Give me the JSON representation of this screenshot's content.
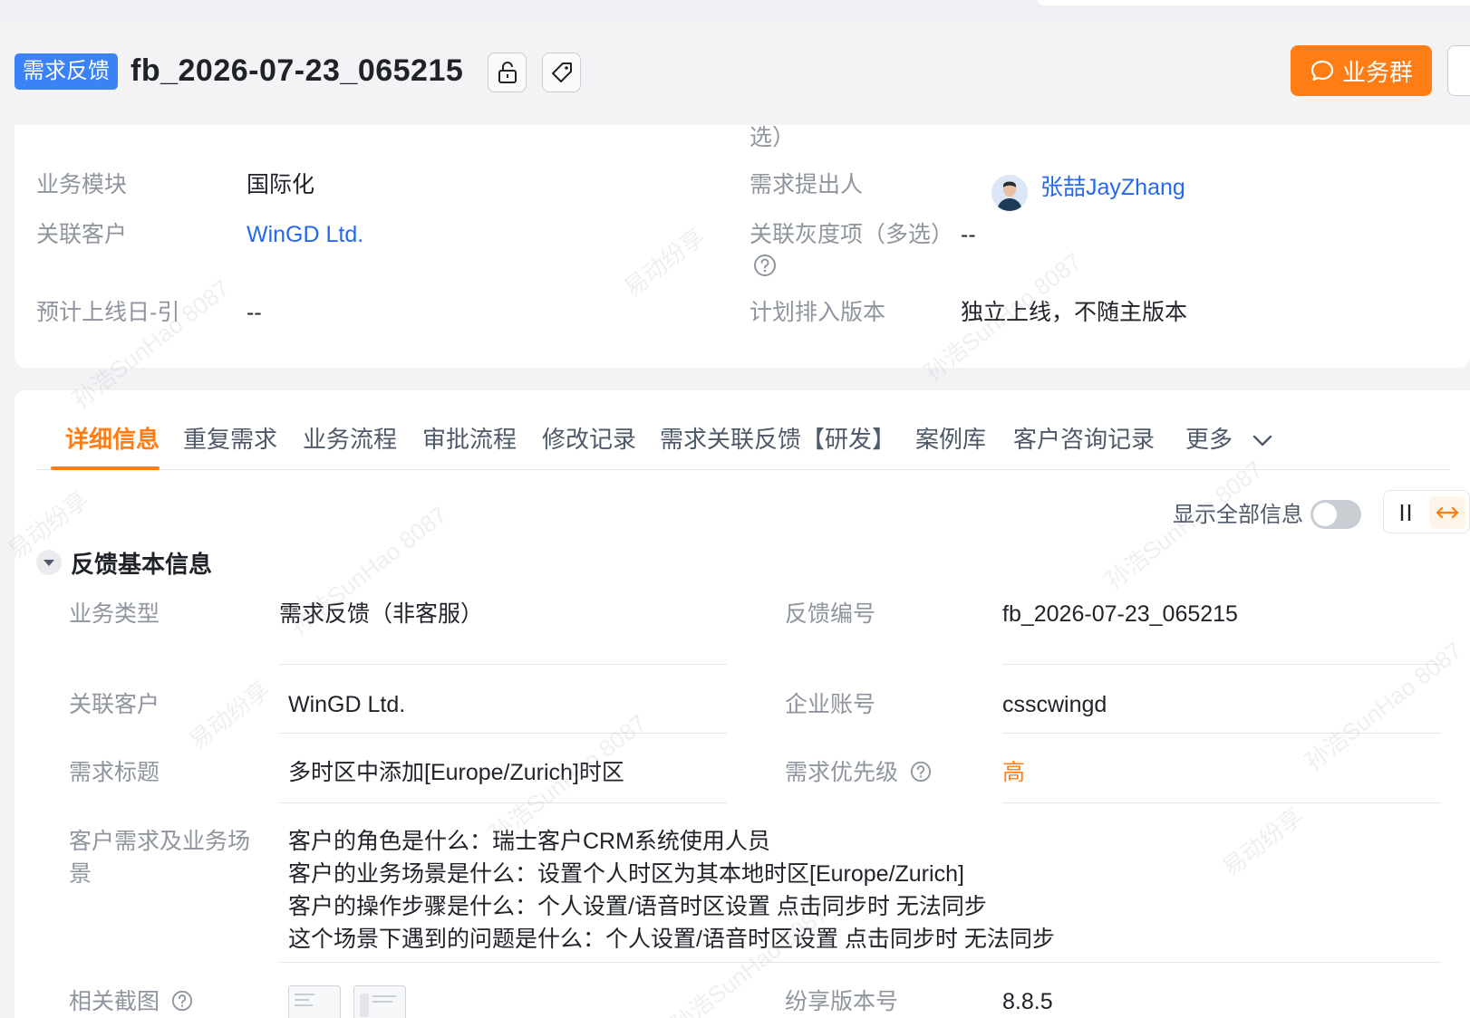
{
  "header": {
    "type_tag": "需求反馈",
    "title": "fb_2026-07-23_065215",
    "group_button": "业务群"
  },
  "summary": {
    "overflow_text": "选）",
    "fields": [
      {
        "label": "业务模块",
        "value": "国际化"
      },
      {
        "label": "关联客户",
        "value": "WinGD Ltd."
      },
      {
        "label": "预计上线日-引",
        "value": "--"
      },
      {
        "label": "需求提出人",
        "value": "张喆JayZhang"
      },
      {
        "label": "关联灰度项（多选）",
        "value": "--"
      },
      {
        "label": "计划排入版本",
        "value": "独立上线，不随主版本"
      }
    ]
  },
  "tabs": [
    {
      "label": "详细信息",
      "active": true
    },
    {
      "label": "重复需求"
    },
    {
      "label": "业务流程"
    },
    {
      "label": "审批流程"
    },
    {
      "label": "修改记录"
    },
    {
      "label": "需求关联反馈【研发】"
    },
    {
      "label": "案例库"
    },
    {
      "label": "客户咨询记录"
    },
    {
      "label": "更多"
    }
  ],
  "toolbar": {
    "show_all_label": "显示全部信息",
    "show_all_on": false
  },
  "section": {
    "title": "反馈基本信息",
    "fields": {
      "biz_type": {
        "label": "业务类型",
        "value": "需求反馈（非客服）"
      },
      "feedback_no": {
        "label": "反馈编号",
        "value": "fb_2026-07-23_065215"
      },
      "customer": {
        "label": "关联客户",
        "value": "WinGD Ltd."
      },
      "account": {
        "label": "企业账号",
        "value": "csscwingd"
      },
      "req_title": {
        "label": "需求标题",
        "value": "多时区中添加[Europe/Zurich]时区"
      },
      "priority": {
        "label": "需求优先级",
        "value": "高"
      },
      "scenario": {
        "label": "客户需求及业务场景",
        "lines": [
          "客户的角色是什么：瑞士客户CRM系统使用人员",
          "客户的业务场景是什么：设置个人时区为其本地时区[Europe/Zurich]",
          "客户的操作步骤是什么：个人设置/语音时区设置 点击同步时 无法同步",
          "这个场景下遇到的问题是什么：个人设置/语音时区设置 点击同步时 无法同步"
        ]
      },
      "screenshots": {
        "label": "相关截图"
      },
      "version": {
        "label": "纷享版本号",
        "value": "8.8.5"
      }
    }
  },
  "watermark": [
    "孙浩SunHao 8087",
    "易动纷享"
  ],
  "colors": {
    "accent": "#ff7d14",
    "link": "#2468f2",
    "tag": "#3b82f6"
  }
}
